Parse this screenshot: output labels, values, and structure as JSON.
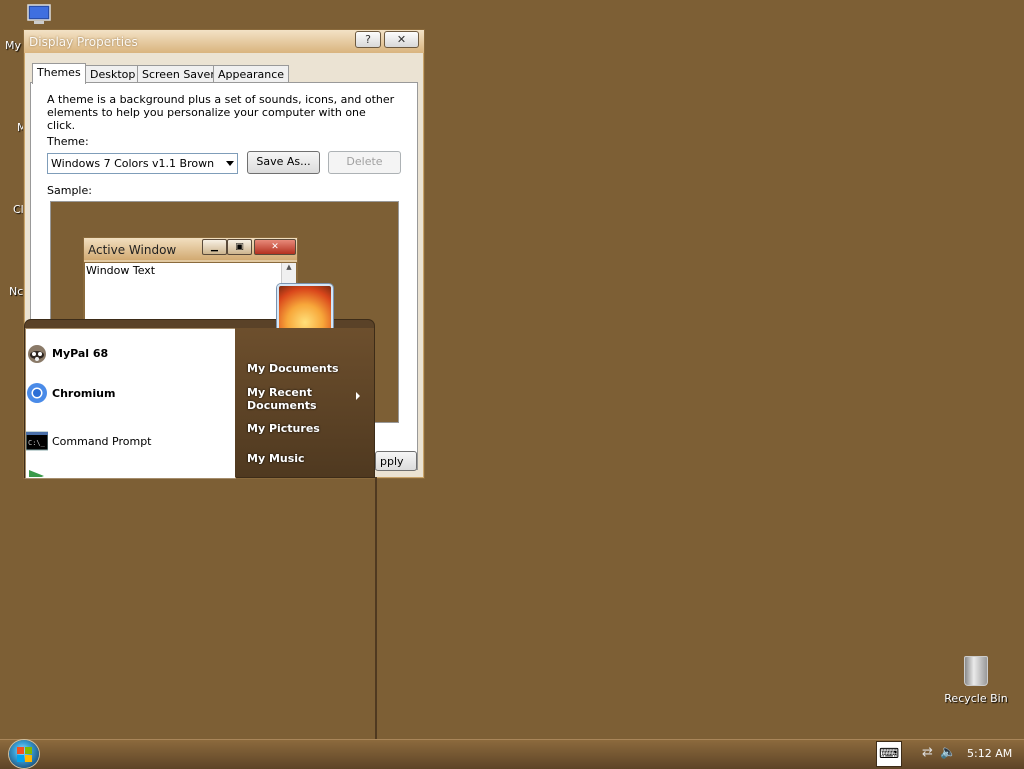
{
  "desktop": {
    "background_color": "#7d5f35",
    "icons": [
      {
        "label": "My",
        "icon": "my-computer-icon"
      },
      {
        "label": "M"
      },
      {
        "label": "Cl"
      },
      {
        "label": "Nc"
      }
    ],
    "recycle_bin": {
      "label": "Recycle Bin",
      "icon": "recycle-bin-icon"
    }
  },
  "dialog": {
    "title": "Display Properties",
    "help_button": "?",
    "close_button": "✕",
    "tabs": [
      {
        "label": "Themes",
        "active": true
      },
      {
        "label": "Desktop"
      },
      {
        "label": "Screen Saver"
      },
      {
        "label": "Appearance"
      }
    ],
    "description": "A theme is a background plus a set of sounds, icons, and other elements to help you personalize your computer with one click.",
    "theme_label": "Theme:",
    "theme_value": "Windows 7 Colors v1.1 Brown",
    "save_as": "Save As...",
    "delete": "Delete",
    "sample_label": "Sample:",
    "sample_window_title": "Active Window",
    "sample_window_text": "Window Text",
    "apply_partial": "pply"
  },
  "start_menu": {
    "left_items": [
      {
        "label": "MyPal 68",
        "icon": "mypal-icon",
        "bold": true
      },
      {
        "label": "Chromium",
        "icon": "chromium-icon",
        "bold": true
      },
      {
        "label": "Command Prompt",
        "icon": "command-prompt-icon",
        "bold": false
      }
    ],
    "right_items": [
      {
        "label": "My Documents"
      },
      {
        "label": "My Recent Documents",
        "submenu": true
      },
      {
        "label": "My Pictures"
      },
      {
        "label": "My Music"
      }
    ]
  },
  "taskbar": {
    "clock": "5:12 AM",
    "start_icon": "start-orb-icon",
    "tray_icons": [
      "keyboard-icon",
      "network-icon",
      "volume-icon"
    ]
  }
}
